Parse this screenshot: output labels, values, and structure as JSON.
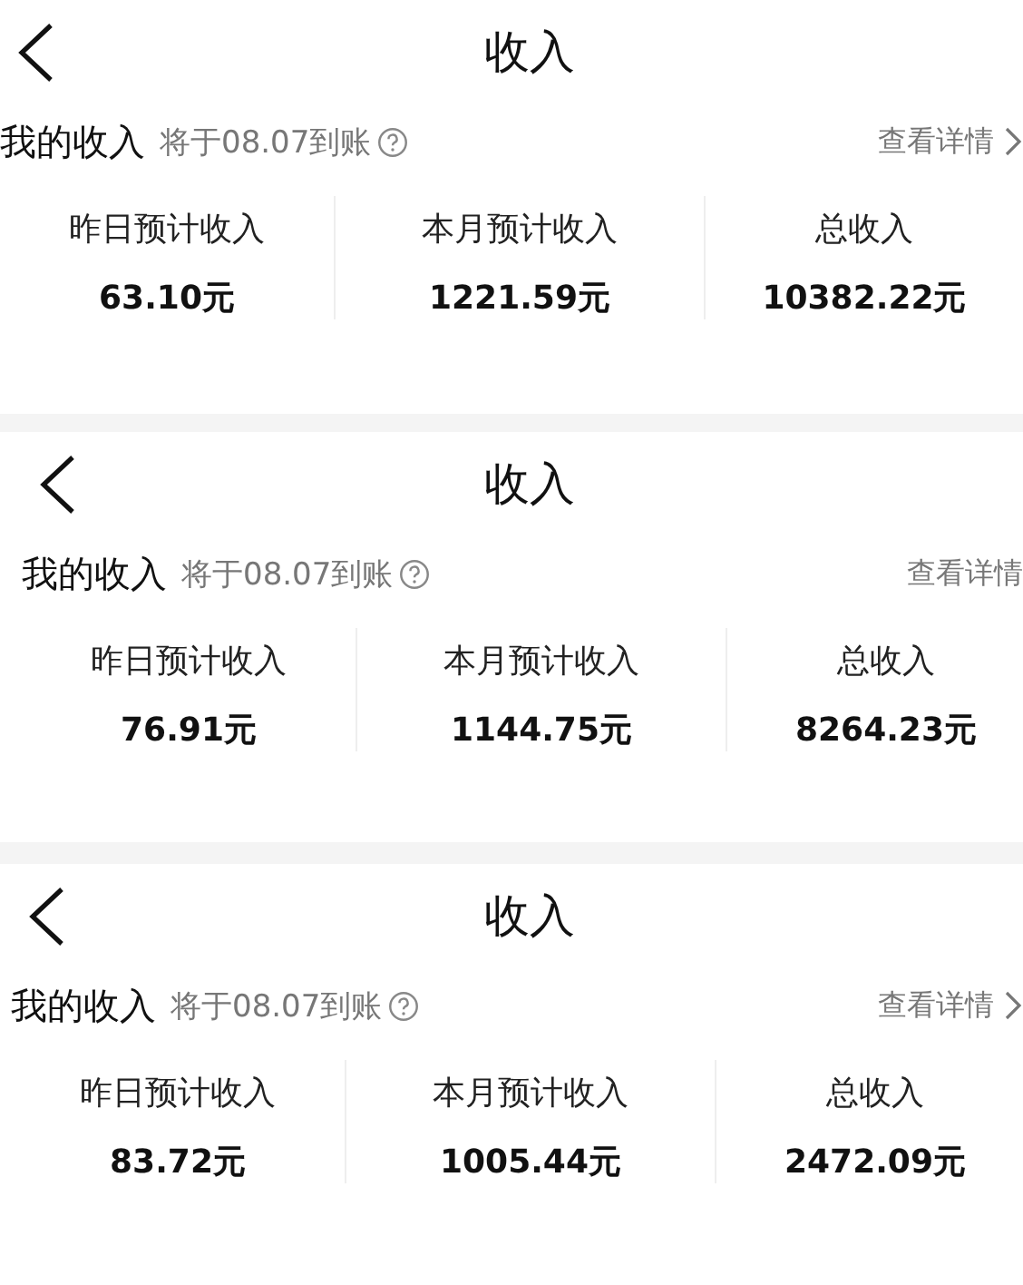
{
  "panels": [
    {
      "title": "收入",
      "income": {
        "label": "我的收入",
        "note": "将于08.07到账",
        "link": "查看详情",
        "chevron": true
      },
      "stats": [
        {
          "label": "昨日预计收入",
          "value": "63.10元"
        },
        {
          "label": "本月预计收入",
          "value": "1221.59元"
        },
        {
          "label": "总收入",
          "value": "10382.22元"
        }
      ]
    },
    {
      "title": "收入",
      "income": {
        "label": "我的收入",
        "note": "将于08.07到账",
        "link": "查看详情",
        "chevron": false
      },
      "stats": [
        {
          "label": "昨日预计收入",
          "value": "76.91元"
        },
        {
          "label": "本月预计收入",
          "value": "1144.75元"
        },
        {
          "label": "总收入",
          "value": "8264.23元"
        }
      ]
    },
    {
      "title": "收入",
      "income": {
        "label": "我的收入",
        "note": "将于08.07到账",
        "link": "查看详情",
        "chevron": true
      },
      "stats": [
        {
          "label": "昨日预计收入",
          "value": "83.72元"
        },
        {
          "label": "本月预计收入",
          "value": "1005.44元"
        },
        {
          "label": "总收入",
          "value": "2472.09元"
        }
      ]
    }
  ]
}
